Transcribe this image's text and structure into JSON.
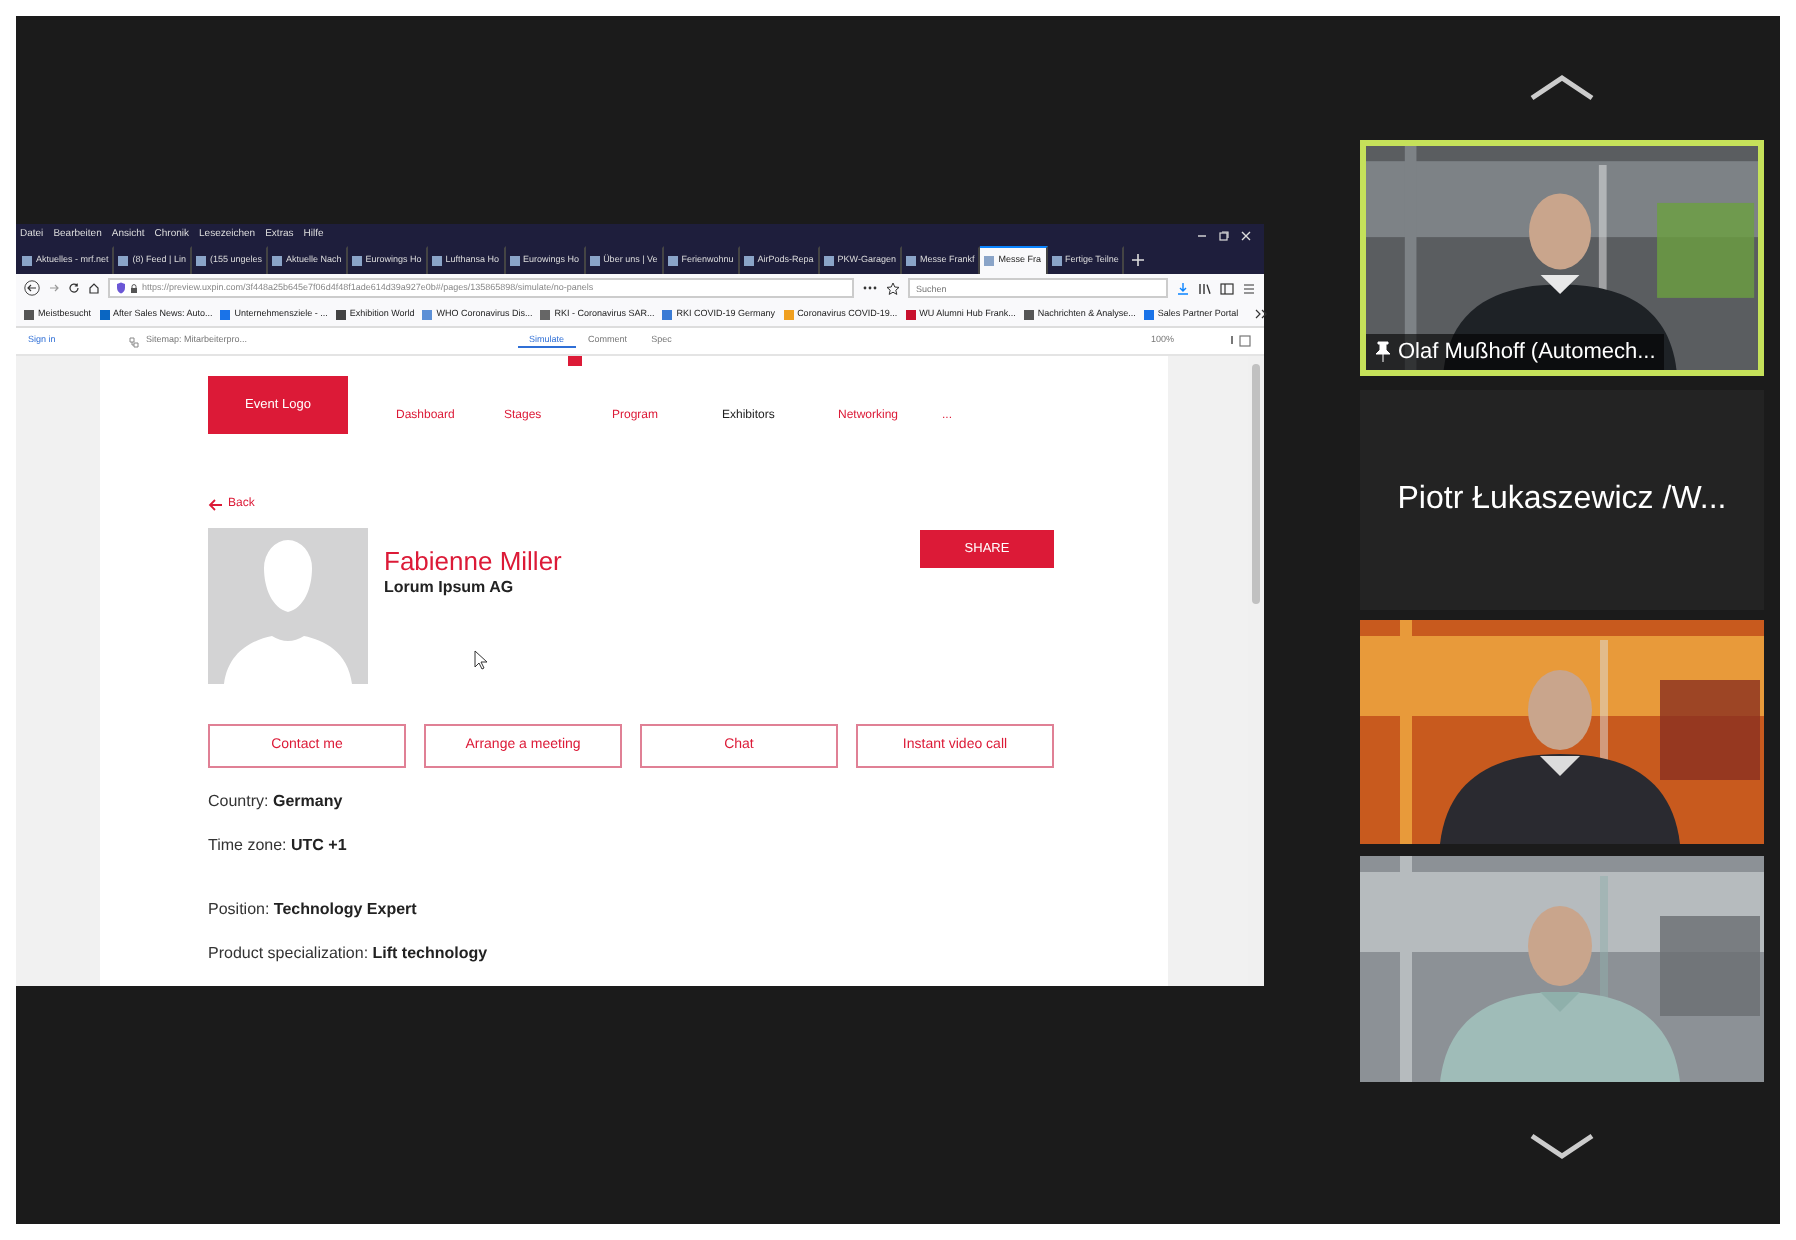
{
  "browser": {
    "menu": [
      "Datei",
      "Bearbeiten",
      "Ansicht",
      "Chronik",
      "Lesezeichen",
      "Extras",
      "Hilfe"
    ],
    "tabs": [
      {
        "label": "Aktuelles - mrf.net",
        "selected": false
      },
      {
        "label": "(8) Feed | Lin",
        "selected": false
      },
      {
        "label": "(155 ungeles",
        "selected": false
      },
      {
        "label": "Aktuelle Nach",
        "selected": false
      },
      {
        "label": "Eurowings Ho",
        "selected": false
      },
      {
        "label": "Lufthansa Ho",
        "selected": false
      },
      {
        "label": "Eurowings Ho",
        "selected": false
      },
      {
        "label": "Über uns | Ve",
        "selected": false
      },
      {
        "label": "Ferienwohnu",
        "selected": false
      },
      {
        "label": "AirPods-Repa",
        "selected": false
      },
      {
        "label": "PKW-Garagen",
        "selected": false
      },
      {
        "label": "Messe Frankf",
        "selected": false
      },
      {
        "label": "Messe Fra",
        "selected": true
      },
      {
        "label": "Fertige Teilne",
        "selected": false
      }
    ],
    "url": "https://preview.uxpin.com/3f448a25b645e7f06d4f48f1ade614d39a927e0b#/pages/135865898/simulate/no-panels",
    "search_placeholder": "Suchen",
    "bookmarks": [
      "Meistbesucht",
      "After Sales News: Auto...",
      "Unternehmensziele - ...",
      "Exhibition World",
      "WHO Coronavirus Dis...",
      "RKI - Coronavirus SAR...",
      "RKI COVID-19 Germany",
      "Coronavirus COVID-19...",
      "WU Alumni Hub Frank...",
      "Nachrichten & Analyse...",
      "Sales Partner Portal"
    ]
  },
  "uxpin_bar": {
    "sign_in": "Sign in",
    "sitemap": "Sitemap: Mitarbeiterpro...",
    "modes": [
      {
        "label": "Simulate",
        "selected": true
      },
      {
        "label": "Comment",
        "selected": false
      },
      {
        "label": "Spec",
        "selected": false
      }
    ],
    "zoom": "100%"
  },
  "page": {
    "logo": "Event Logo",
    "nav": [
      {
        "label": "Dashboard",
        "selected": false
      },
      {
        "label": "Stages",
        "selected": false
      },
      {
        "label": "Program",
        "selected": false
      },
      {
        "label": "Exhibitors",
        "selected": true
      },
      {
        "label": "Networking",
        "selected": false
      },
      {
        "label": "...",
        "selected": false
      }
    ],
    "back": "Back",
    "name": "Fabienne Miller",
    "company": "Lorum Ipsum AG",
    "share": "SHARE",
    "actions": [
      "Contact me",
      "Arrange a meeting",
      "Chat",
      "Instant video call"
    ],
    "detail_groups": [
      [
        {
          "label": "Country:",
          "value": "Germany"
        },
        {
          "label": "Time zone:",
          "value": "UTC +1"
        }
      ],
      [
        {
          "label": "Position:",
          "value": "Technology Expert"
        },
        {
          "label": "Product specialization:",
          "value": "Lift technology"
        }
      ]
    ]
  },
  "participants": [
    {
      "kind": "video",
      "name": "Olaf Mußhoff (Automech...",
      "pinned": true,
      "speaking": true
    },
    {
      "kind": "name",
      "name": "Piotr Łukaszewicz /W..."
    },
    {
      "kind": "video"
    },
    {
      "kind": "video"
    }
  ]
}
